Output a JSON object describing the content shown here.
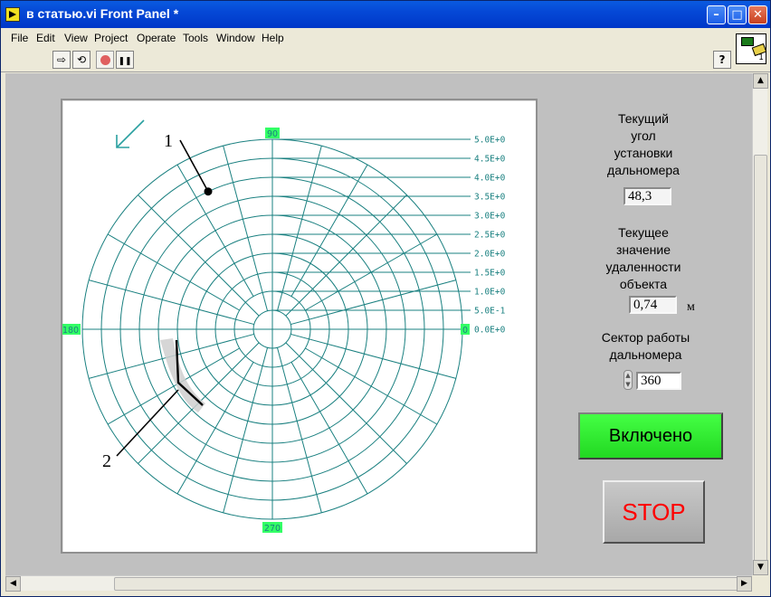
{
  "window": {
    "title": "в статью.vi Front Panel *"
  },
  "menu": [
    "File",
    "Edit",
    "View",
    "Project",
    "Operate",
    "Tools",
    "Window",
    "Help"
  ],
  "vi_icon": {
    "number": "1"
  },
  "polar_plot": {
    "angle_labels": {
      "a90": "90",
      "a180": "180",
      "a0": "0",
      "a270": "270"
    },
    "radius_labels": [
      "0.0E+0",
      "5.0E-1",
      "1.0E+0",
      "1.5E+0",
      "2.0E+0",
      "2.5E+0",
      "3.0E+0",
      "3.5E+0",
      "4.0E+0",
      "4.5E+0",
      "5.0E+0"
    ],
    "radius_max": 5.0,
    "ring_count": 10,
    "spoke_step_deg": 15,
    "grid_color": "#1a8080",
    "angle_label_bg": "#33ff66",
    "marker": {
      "angle_deg": 115,
      "radius": 4.0
    },
    "annotation_1": "1",
    "annotation_2": "2"
  },
  "controls": {
    "angle_label": [
      "Текущий",
      "угол",
      "установки",
      "дальномера"
    ],
    "angle_value": "48,3",
    "distance_label": [
      "Текущее",
      "значение",
      "удаленности",
      "объекта"
    ],
    "distance_value": "0,74",
    "distance_unit": "м",
    "sector_label": [
      "Сектор работы",
      "дальномера"
    ],
    "sector_value": "360",
    "on_button": "Включено",
    "stop_button": "STOP"
  }
}
